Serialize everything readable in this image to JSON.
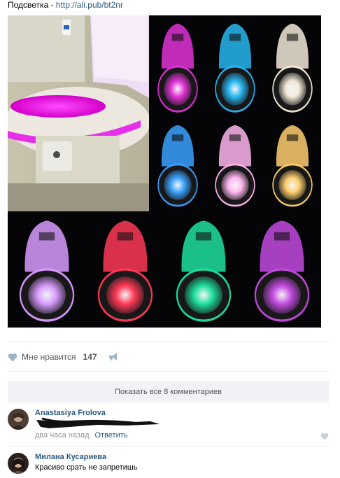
{
  "post": {
    "text_prefix": "Подсветка - ",
    "link_text": "http://ali.pub/bt2nr"
  },
  "collage": {
    "tiles": [
      {
        "color": "#e233d6"
      },
      {
        "color": "#27b7f0"
      },
      {
        "color": "#f3ead8"
      },
      {
        "color": "#3aa3ff"
      },
      {
        "color": "#ffb6ef"
      },
      {
        "color": "#ffcf6e"
      },
      {
        "color": "#d89cff"
      },
      {
        "color": "#ff3a57"
      },
      {
        "color": "#1fe0a0"
      },
      {
        "color": "#c44be0"
      }
    ],
    "big_photo_glow": "#ff19ff"
  },
  "actions": {
    "like_label": "Мне нравится",
    "like_count": "147"
  },
  "comments": {
    "show_all_label": "Показать все 8 комментариев",
    "items": [
      {
        "author": "Anastasiya Frolova",
        "text": "",
        "time": "два часа назад",
        "reply_label": "Ответить"
      },
      {
        "author": "Милана Кусариева",
        "text": "Красиво срать не запретишь"
      }
    ]
  },
  "colors": {
    "link": "#2a5885",
    "muted": "#939393",
    "bar_bg": "#f0f2f5"
  }
}
